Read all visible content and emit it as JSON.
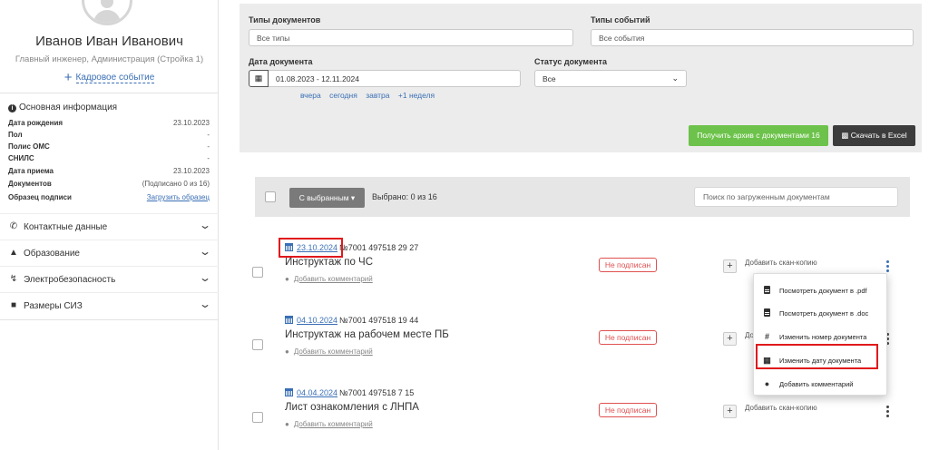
{
  "profile": {
    "name": "Иванов Иван Иванович",
    "role": "Главный инженер, Администрация (Стройка 1)",
    "hr_event_label": "Кадровое событие"
  },
  "basic_info": {
    "title": "Основная информация",
    "rows": [
      {
        "key": "Дата рождения",
        "value": "23.10.2023"
      },
      {
        "key": "Пол",
        "value": "-"
      },
      {
        "key": "Полис ОМС",
        "value": "-"
      },
      {
        "key": "СНИЛС",
        "value": "-"
      },
      {
        "key": "Дата приема",
        "value": "23.10.2023"
      },
      {
        "key": "Документов",
        "value": "(Подписано 0 из 16)"
      },
      {
        "key": "Образец подписи",
        "value": "Загрузить образец"
      }
    ]
  },
  "sections": [
    {
      "label": "Контактные данные",
      "icon": "phone-icon"
    },
    {
      "label": "Образование",
      "icon": "graduation-cap-icon"
    },
    {
      "label": "Электробезопасность",
      "icon": "bolt-icon"
    },
    {
      "label": "Размеры СИЗ",
      "icon": "hard-hat-icon"
    }
  ],
  "filters": {
    "doc_types_label": "Типы документов",
    "doc_types_value": "Все типы",
    "event_types_label": "Типы событий",
    "event_types_value": "Все события",
    "doc_date_label": "Дата документа",
    "doc_date_value": "01.08.2023 - 12.11.2024",
    "quick_dates": [
      "вчера",
      "сегодня",
      "завтра",
      "+1 неделя"
    ],
    "status_label": "Статус документа",
    "status_value": "Все",
    "archive_button": "Получить архив с документами 16",
    "excel_button": "Скачать в Excel"
  },
  "toolbar": {
    "bulk_button": "С выбранным ▾",
    "selected": "Выбрано: 0 из 16",
    "search_placeholder": "Поиск по загруженным документам"
  },
  "documents": [
    {
      "date": "23.10.2024",
      "number": "№7001 497518 29 27",
      "title": "Инструктаж по ЧС",
      "comment": "Добавить комментарий",
      "status": "Не подписан",
      "scan": "Добавить скан-копию"
    },
    {
      "date": "04.10.2024",
      "number": "№7001 497518 19 44",
      "title": "Инструктаж на рабочем месте ПБ",
      "comment": "Добавить комментарий",
      "status": "Не подписан",
      "scan": "До"
    },
    {
      "date": "04.04.2024",
      "number": "№7001 497518 7 15",
      "title": "Лист ознакомления с ЛНПА",
      "comment": "Добавить комментарий",
      "status": "Не подписан",
      "scan": "Добавить скан-копию"
    }
  ],
  "menu": [
    {
      "label": "Посмотреть документ в .pdf",
      "icon": "file-pdf-icon"
    },
    {
      "label": "Посмотреть документ в .doc",
      "icon": "file-word-icon"
    },
    {
      "label": "Изменить номер документа",
      "icon": "hashtag-icon"
    },
    {
      "label": "Изменить дату документа",
      "icon": "calendar-icon"
    },
    {
      "label": "Добавить комментарий",
      "icon": "comments-icon"
    }
  ],
  "colors": {
    "accent_link": "#3a6fb5",
    "archive_green": "#6cc24a",
    "excel_dark": "#3c3c3c",
    "status_red": "#e05050",
    "highlight_red": "#e0191c"
  }
}
